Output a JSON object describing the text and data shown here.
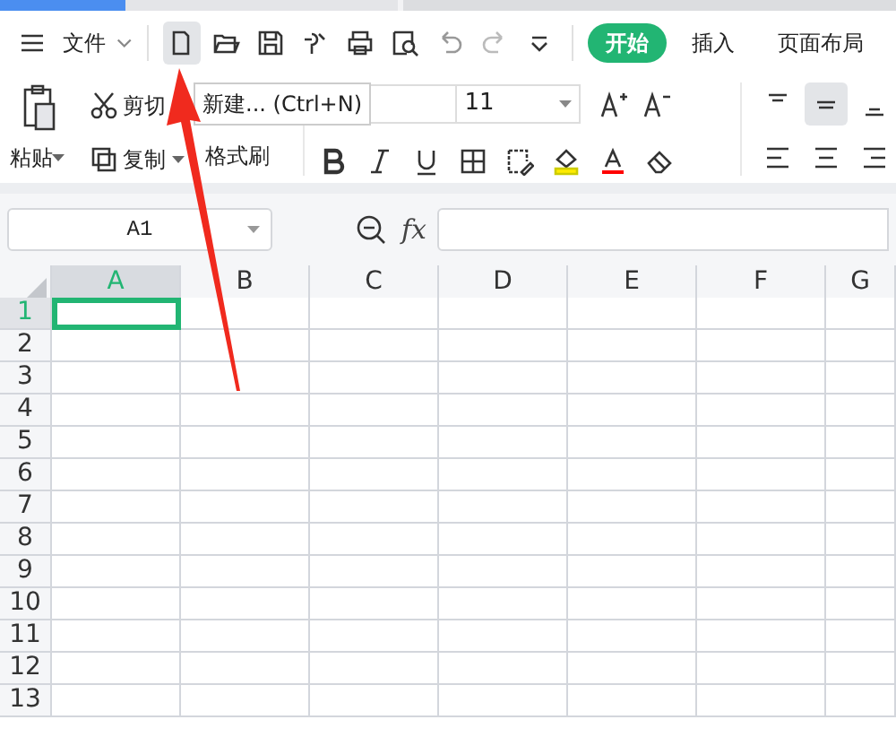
{
  "toolbar": {
    "menu_label": "文件",
    "new_button": {
      "hovered": true
    },
    "tabs": [
      {
        "label": "开始",
        "selected": true
      },
      {
        "label": "插入",
        "selected": false
      },
      {
        "label": "页面布局",
        "selected": false
      }
    ]
  },
  "tooltip": "新建... (Ctrl+N)",
  "clipboard": {
    "paste": "粘贴",
    "cut": "剪切",
    "copy": "复制",
    "format_painter": "格式刷"
  },
  "font_size": "11",
  "vertical_align": [
    {
      "selected": false
    },
    {
      "selected": true
    },
    {
      "selected": false
    }
  ],
  "name_box": "A1",
  "formula_label": "fx",
  "columns": [
    {
      "label": "A",
      "selected": true
    },
    {
      "label": "B",
      "selected": false
    },
    {
      "label": "C",
      "selected": false
    },
    {
      "label": "D",
      "selected": false
    },
    {
      "label": "E",
      "selected": false
    },
    {
      "label": "F",
      "selected": false
    },
    {
      "label": "G",
      "selected": false
    }
  ],
  "rows": [
    {
      "label": "1",
      "selected": true
    },
    {
      "label": "2",
      "selected": false
    },
    {
      "label": "3",
      "selected": false
    },
    {
      "label": "4",
      "selected": false
    },
    {
      "label": "5",
      "selected": false
    },
    {
      "label": "6",
      "selected": false
    },
    {
      "label": "7",
      "selected": false
    },
    {
      "label": "8",
      "selected": false
    },
    {
      "label": "9",
      "selected": false
    },
    {
      "label": "10",
      "selected": false
    },
    {
      "label": "11",
      "selected": false
    },
    {
      "label": "12",
      "selected": false
    },
    {
      "label": "13",
      "selected": false
    }
  ]
}
